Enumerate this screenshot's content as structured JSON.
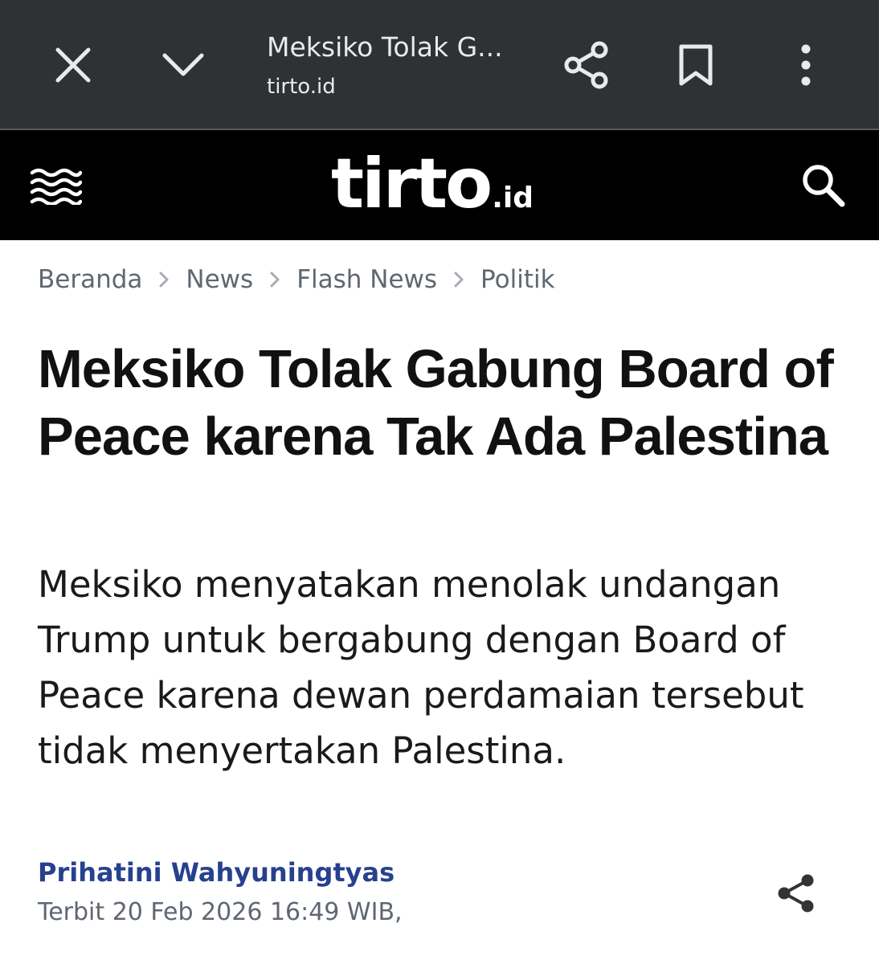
{
  "browser": {
    "page_title": "Meksiko Tolak G...",
    "url": "tirto.id",
    "icons": {
      "close": "close-icon",
      "minimize": "chevron-down-icon",
      "share": "share-icon",
      "bookmark": "bookmark-icon",
      "menu": "more-vertical-icon"
    }
  },
  "site_header": {
    "logo_main": "tirto",
    "logo_suffix": ".id",
    "icons": {
      "menu": "wave-menu-icon",
      "search": "search-icon"
    }
  },
  "breadcrumb": [
    "Beranda",
    "News",
    "Flash News",
    "Politik"
  ],
  "article": {
    "headline": "Meksiko Tolak Gabung Board of Peace karena Tak Ada Palestina",
    "lede": "Meksiko menyatakan menolak undangan Trump untuk bergabung dengan Board of Peace karena dewan perdamaian tersebut tidak menyertakan Palestina.",
    "author": "Prihatini Wahyuningtyas",
    "published": "Terbit 20 Feb 2026 16:49 WIB,"
  },
  "colors": {
    "chrome_bg": "#303134",
    "header_bg": "#000000",
    "author_link": "#27418f",
    "meta_text": "#5f6771"
  }
}
